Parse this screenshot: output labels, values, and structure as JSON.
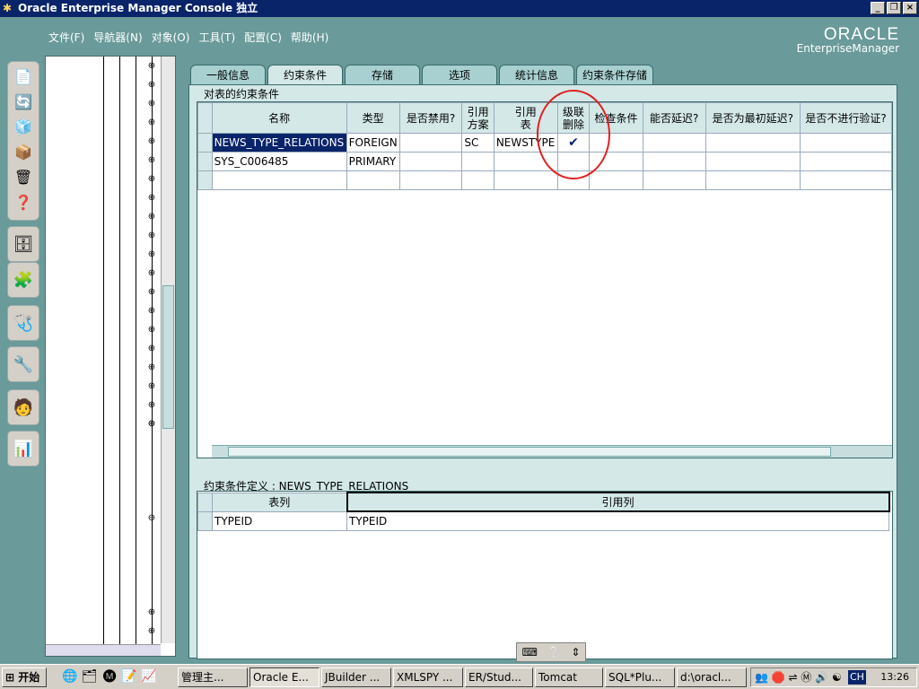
{
  "window": {
    "title": "Oracle Enterprise Manager Console 独立",
    "buttons": [
      "_",
      "❐",
      "×"
    ]
  },
  "menu": [
    "文件(F)",
    "导航器(N)",
    "对象(O)",
    "工具(T)",
    "配置(C)",
    "帮助(H)"
  ],
  "logo": {
    "line1": "ORACLE",
    "line2": "EnterpriseManager"
  },
  "tabs": [
    "一般信息",
    "约束条件",
    "存储",
    "选项",
    "统计信息",
    "约束条件存储"
  ],
  "active_tab": "约束条件",
  "constraints": {
    "group_label": "对表的约束条件",
    "columns": [
      "名称",
      "类型",
      "是否禁用?",
      "引用\n方案",
      "引用\n表",
      "级联\n删除",
      "检查条件",
      "能否延迟?",
      "是否为最初延迟?",
      "是否不进行验证?"
    ],
    "rows": [
      [
        "NEWS_TYPE_RELATIONS",
        "FOREIGN",
        "",
        "SC",
        "NEWSTYPE",
        "✔",
        "",
        "",
        "",
        ""
      ],
      [
        "SYS_C006485",
        "PRIMARY",
        "",
        "",
        "",
        "",
        "",
        "",
        "",
        ""
      ]
    ]
  },
  "definition": {
    "group_label": "约束条件定义 : NEWS_TYPE_RELATIONS",
    "columns": [
      "表列",
      "引用列"
    ],
    "rows": [
      [
        "TYPEID",
        "TYPEID"
      ]
    ]
  },
  "taskbar": {
    "start": "开始",
    "items": [
      "管理主...",
      "Oracle E...",
      "JBuilder ...",
      "XMLSPY ...",
      "ER/Stud...",
      "Tomcat",
      "SQL*Plu...",
      "d:\\oracl..."
    ],
    "active_index": 1,
    "lang": "CH",
    "clock": "13:26"
  }
}
